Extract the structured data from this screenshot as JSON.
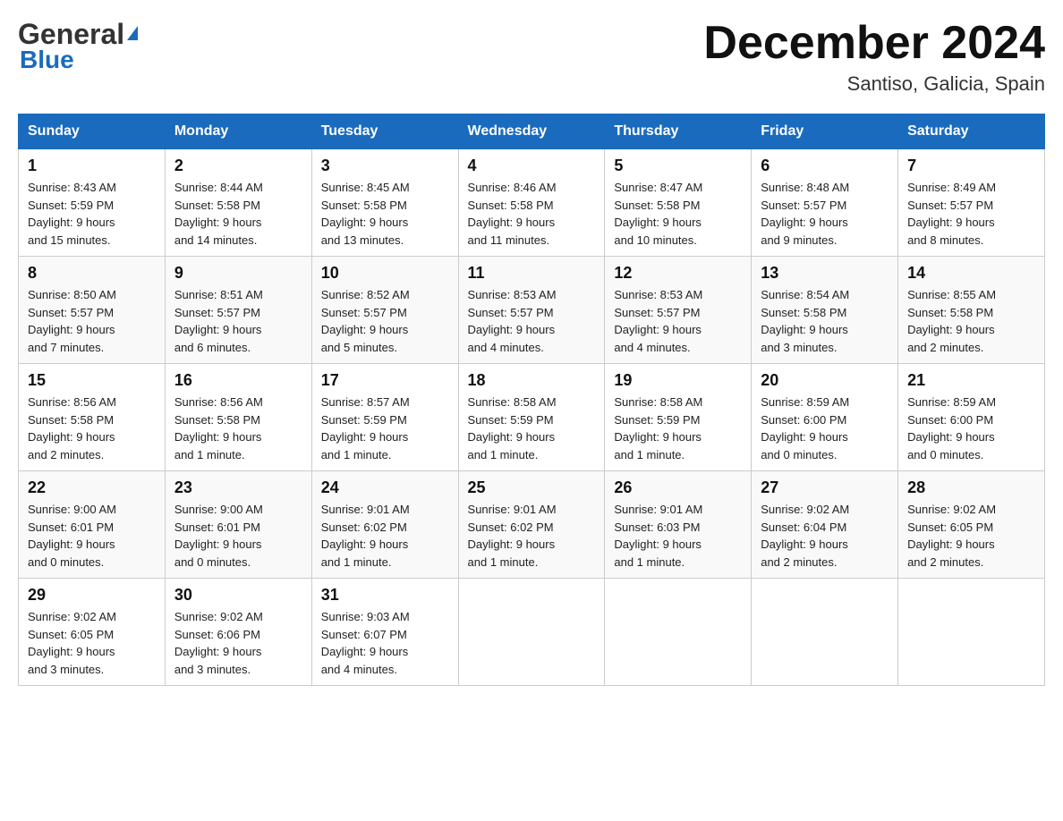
{
  "header": {
    "logo_top": "General",
    "logo_triangle": "▶",
    "logo_bottom": "Blue",
    "title": "December 2024",
    "subtitle": "Santiso, Galicia, Spain"
  },
  "calendar": {
    "days_of_week": [
      "Sunday",
      "Monday",
      "Tuesday",
      "Wednesday",
      "Thursday",
      "Friday",
      "Saturday"
    ],
    "weeks": [
      [
        {
          "day": "1",
          "info": "Sunrise: 8:43 AM\nSunset: 5:59 PM\nDaylight: 9 hours\nand 15 minutes."
        },
        {
          "day": "2",
          "info": "Sunrise: 8:44 AM\nSunset: 5:58 PM\nDaylight: 9 hours\nand 14 minutes."
        },
        {
          "day": "3",
          "info": "Sunrise: 8:45 AM\nSunset: 5:58 PM\nDaylight: 9 hours\nand 13 minutes."
        },
        {
          "day": "4",
          "info": "Sunrise: 8:46 AM\nSunset: 5:58 PM\nDaylight: 9 hours\nand 11 minutes."
        },
        {
          "day": "5",
          "info": "Sunrise: 8:47 AM\nSunset: 5:58 PM\nDaylight: 9 hours\nand 10 minutes."
        },
        {
          "day": "6",
          "info": "Sunrise: 8:48 AM\nSunset: 5:57 PM\nDaylight: 9 hours\nand 9 minutes."
        },
        {
          "day": "7",
          "info": "Sunrise: 8:49 AM\nSunset: 5:57 PM\nDaylight: 9 hours\nand 8 minutes."
        }
      ],
      [
        {
          "day": "8",
          "info": "Sunrise: 8:50 AM\nSunset: 5:57 PM\nDaylight: 9 hours\nand 7 minutes."
        },
        {
          "day": "9",
          "info": "Sunrise: 8:51 AM\nSunset: 5:57 PM\nDaylight: 9 hours\nand 6 minutes."
        },
        {
          "day": "10",
          "info": "Sunrise: 8:52 AM\nSunset: 5:57 PM\nDaylight: 9 hours\nand 5 minutes."
        },
        {
          "day": "11",
          "info": "Sunrise: 8:53 AM\nSunset: 5:57 PM\nDaylight: 9 hours\nand 4 minutes."
        },
        {
          "day": "12",
          "info": "Sunrise: 8:53 AM\nSunset: 5:57 PM\nDaylight: 9 hours\nand 4 minutes."
        },
        {
          "day": "13",
          "info": "Sunrise: 8:54 AM\nSunset: 5:58 PM\nDaylight: 9 hours\nand 3 minutes."
        },
        {
          "day": "14",
          "info": "Sunrise: 8:55 AM\nSunset: 5:58 PM\nDaylight: 9 hours\nand 2 minutes."
        }
      ],
      [
        {
          "day": "15",
          "info": "Sunrise: 8:56 AM\nSunset: 5:58 PM\nDaylight: 9 hours\nand 2 minutes."
        },
        {
          "day": "16",
          "info": "Sunrise: 8:56 AM\nSunset: 5:58 PM\nDaylight: 9 hours\nand 1 minute."
        },
        {
          "day": "17",
          "info": "Sunrise: 8:57 AM\nSunset: 5:59 PM\nDaylight: 9 hours\nand 1 minute."
        },
        {
          "day": "18",
          "info": "Sunrise: 8:58 AM\nSunset: 5:59 PM\nDaylight: 9 hours\nand 1 minute."
        },
        {
          "day": "19",
          "info": "Sunrise: 8:58 AM\nSunset: 5:59 PM\nDaylight: 9 hours\nand 1 minute."
        },
        {
          "day": "20",
          "info": "Sunrise: 8:59 AM\nSunset: 6:00 PM\nDaylight: 9 hours\nand 0 minutes."
        },
        {
          "day": "21",
          "info": "Sunrise: 8:59 AM\nSunset: 6:00 PM\nDaylight: 9 hours\nand 0 minutes."
        }
      ],
      [
        {
          "day": "22",
          "info": "Sunrise: 9:00 AM\nSunset: 6:01 PM\nDaylight: 9 hours\nand 0 minutes."
        },
        {
          "day": "23",
          "info": "Sunrise: 9:00 AM\nSunset: 6:01 PM\nDaylight: 9 hours\nand 0 minutes."
        },
        {
          "day": "24",
          "info": "Sunrise: 9:01 AM\nSunset: 6:02 PM\nDaylight: 9 hours\nand 1 minute."
        },
        {
          "day": "25",
          "info": "Sunrise: 9:01 AM\nSunset: 6:02 PM\nDaylight: 9 hours\nand 1 minute."
        },
        {
          "day": "26",
          "info": "Sunrise: 9:01 AM\nSunset: 6:03 PM\nDaylight: 9 hours\nand 1 minute."
        },
        {
          "day": "27",
          "info": "Sunrise: 9:02 AM\nSunset: 6:04 PM\nDaylight: 9 hours\nand 2 minutes."
        },
        {
          "day": "28",
          "info": "Sunrise: 9:02 AM\nSunset: 6:05 PM\nDaylight: 9 hours\nand 2 minutes."
        }
      ],
      [
        {
          "day": "29",
          "info": "Sunrise: 9:02 AM\nSunset: 6:05 PM\nDaylight: 9 hours\nand 3 minutes."
        },
        {
          "day": "30",
          "info": "Sunrise: 9:02 AM\nSunset: 6:06 PM\nDaylight: 9 hours\nand 3 minutes."
        },
        {
          "day": "31",
          "info": "Sunrise: 9:03 AM\nSunset: 6:07 PM\nDaylight: 9 hours\nand 4 minutes."
        },
        {
          "day": "",
          "info": ""
        },
        {
          "day": "",
          "info": ""
        },
        {
          "day": "",
          "info": ""
        },
        {
          "day": "",
          "info": ""
        }
      ]
    ]
  }
}
